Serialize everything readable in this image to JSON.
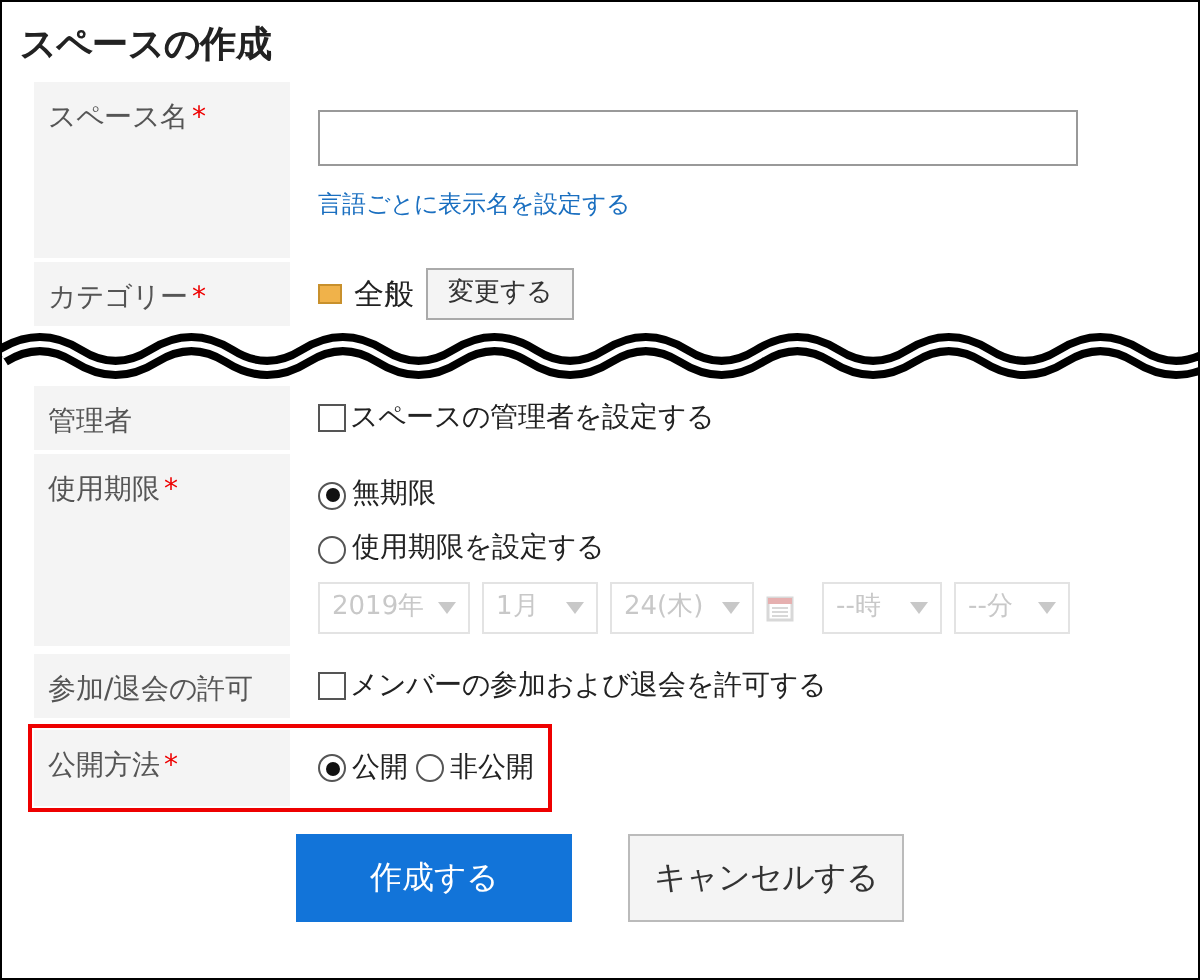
{
  "title": "スペースの作成",
  "rows": [
    {
      "kind": "name",
      "label": "スペース名",
      "required_mark": "*",
      "link": "言語ごとに表示名を設定する"
    },
    {
      "kind": "category",
      "label": "カテゴリー",
      "required_mark": "*",
      "value": "全般",
      "button": "変更する"
    },
    {
      "kind": "checkbox",
      "label": "管理者",
      "option": {
        "label": "スペースの管理者を設定する",
        "checked": false
      }
    },
    {
      "kind": "period",
      "label": "使用期限",
      "required_mark": "*",
      "options": [
        {
          "label": "無期限",
          "selected": true
        },
        {
          "label": "使用期限を設定する",
          "selected": false
        }
      ],
      "disabled": true,
      "selects": [
        {
          "value": "2019年"
        },
        {
          "value": "1月"
        },
        {
          "value": "24(木)"
        },
        {
          "value": "--時"
        },
        {
          "value": "--分"
        }
      ]
    },
    {
      "kind": "checkbox",
      "label": "参加/退会の許可",
      "option": {
        "label": "メンバーの参加および退会を許可する",
        "checked": false
      }
    },
    {
      "kind": "radios",
      "label": "公開方法",
      "required_mark": "*",
      "highlighted": true,
      "options": [
        {
          "label": "公開",
          "selected": true
        },
        {
          "label": "非公開",
          "selected": false
        }
      ]
    }
  ],
  "buttons": [
    {
      "label": "作成する",
      "primary": true
    },
    {
      "label": "キャンセルする",
      "primary": false
    }
  ]
}
